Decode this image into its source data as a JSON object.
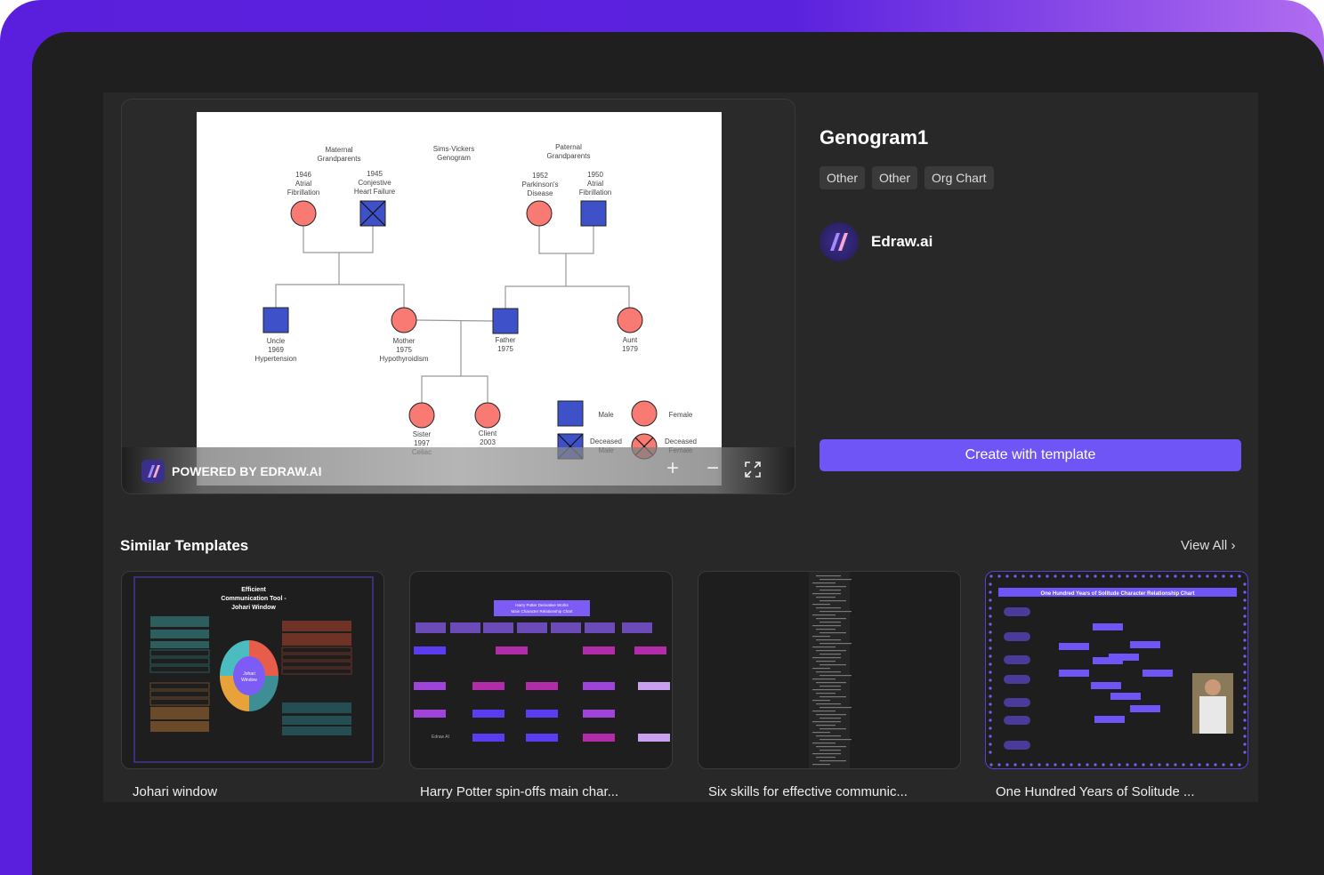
{
  "template": {
    "title": "Genogram1",
    "tags": [
      "Other",
      "Other",
      "Org Chart"
    ],
    "author": "Edraw.ai",
    "create_label": "Create with template"
  },
  "preview": {
    "powered_by": "POWERED BY EDRAW.AI",
    "zoom_in_icon": "plus-icon",
    "zoom_out_icon": "minus-icon",
    "fullscreen_icon": "expand-icon",
    "genogram": {
      "maternal": "Maternal|Grandparents",
      "title": "Sims-Vickers|Genogram",
      "paternal": "Paternal|Grandparents",
      "mgm": "1946|Atrial|Fibrillation",
      "mgf": "1945|Conjestive|Heart Failure",
      "pgm": "1952|Parkinson's|Disease",
      "pgf": "1950|Atrial|Fibrillation",
      "uncle": "Uncle|1969|Hypertension",
      "mother": "Mother|1975|Hypothyroidism",
      "father": "Father|1975",
      "aunt": "Aunt|1979",
      "sister": "Sister|1997|Celiac",
      "client": "Client|2003",
      "legend_male": "Male",
      "legend_female": "Female",
      "legend_deceased_male": "Deceased|Male",
      "legend_deceased_female": "Deceased|Female",
      "colors": {
        "male": "#3f51c8",
        "female": "#f87a72"
      }
    }
  },
  "similar": {
    "title": "Similar Templates",
    "view_all": "View All",
    "items": [
      {
        "label": "Johari window",
        "thumb_title": "Efficient|Communication Tool -|Johari Window",
        "center": "Johari|Window"
      },
      {
        "label": "Harry Potter spin-offs main char...",
        "thumb_title": "Harry Potter Derivative Works|Main Character Relationship Chart",
        "brand": "Edraw AI"
      },
      {
        "label": "Six skills for effective communic..."
      },
      {
        "label": "One Hundred Years of Solitude ...",
        "thumb_title": "One Hundred Years of Solitude Character Relationship Chart"
      }
    ]
  },
  "accent": "#6f55f5"
}
